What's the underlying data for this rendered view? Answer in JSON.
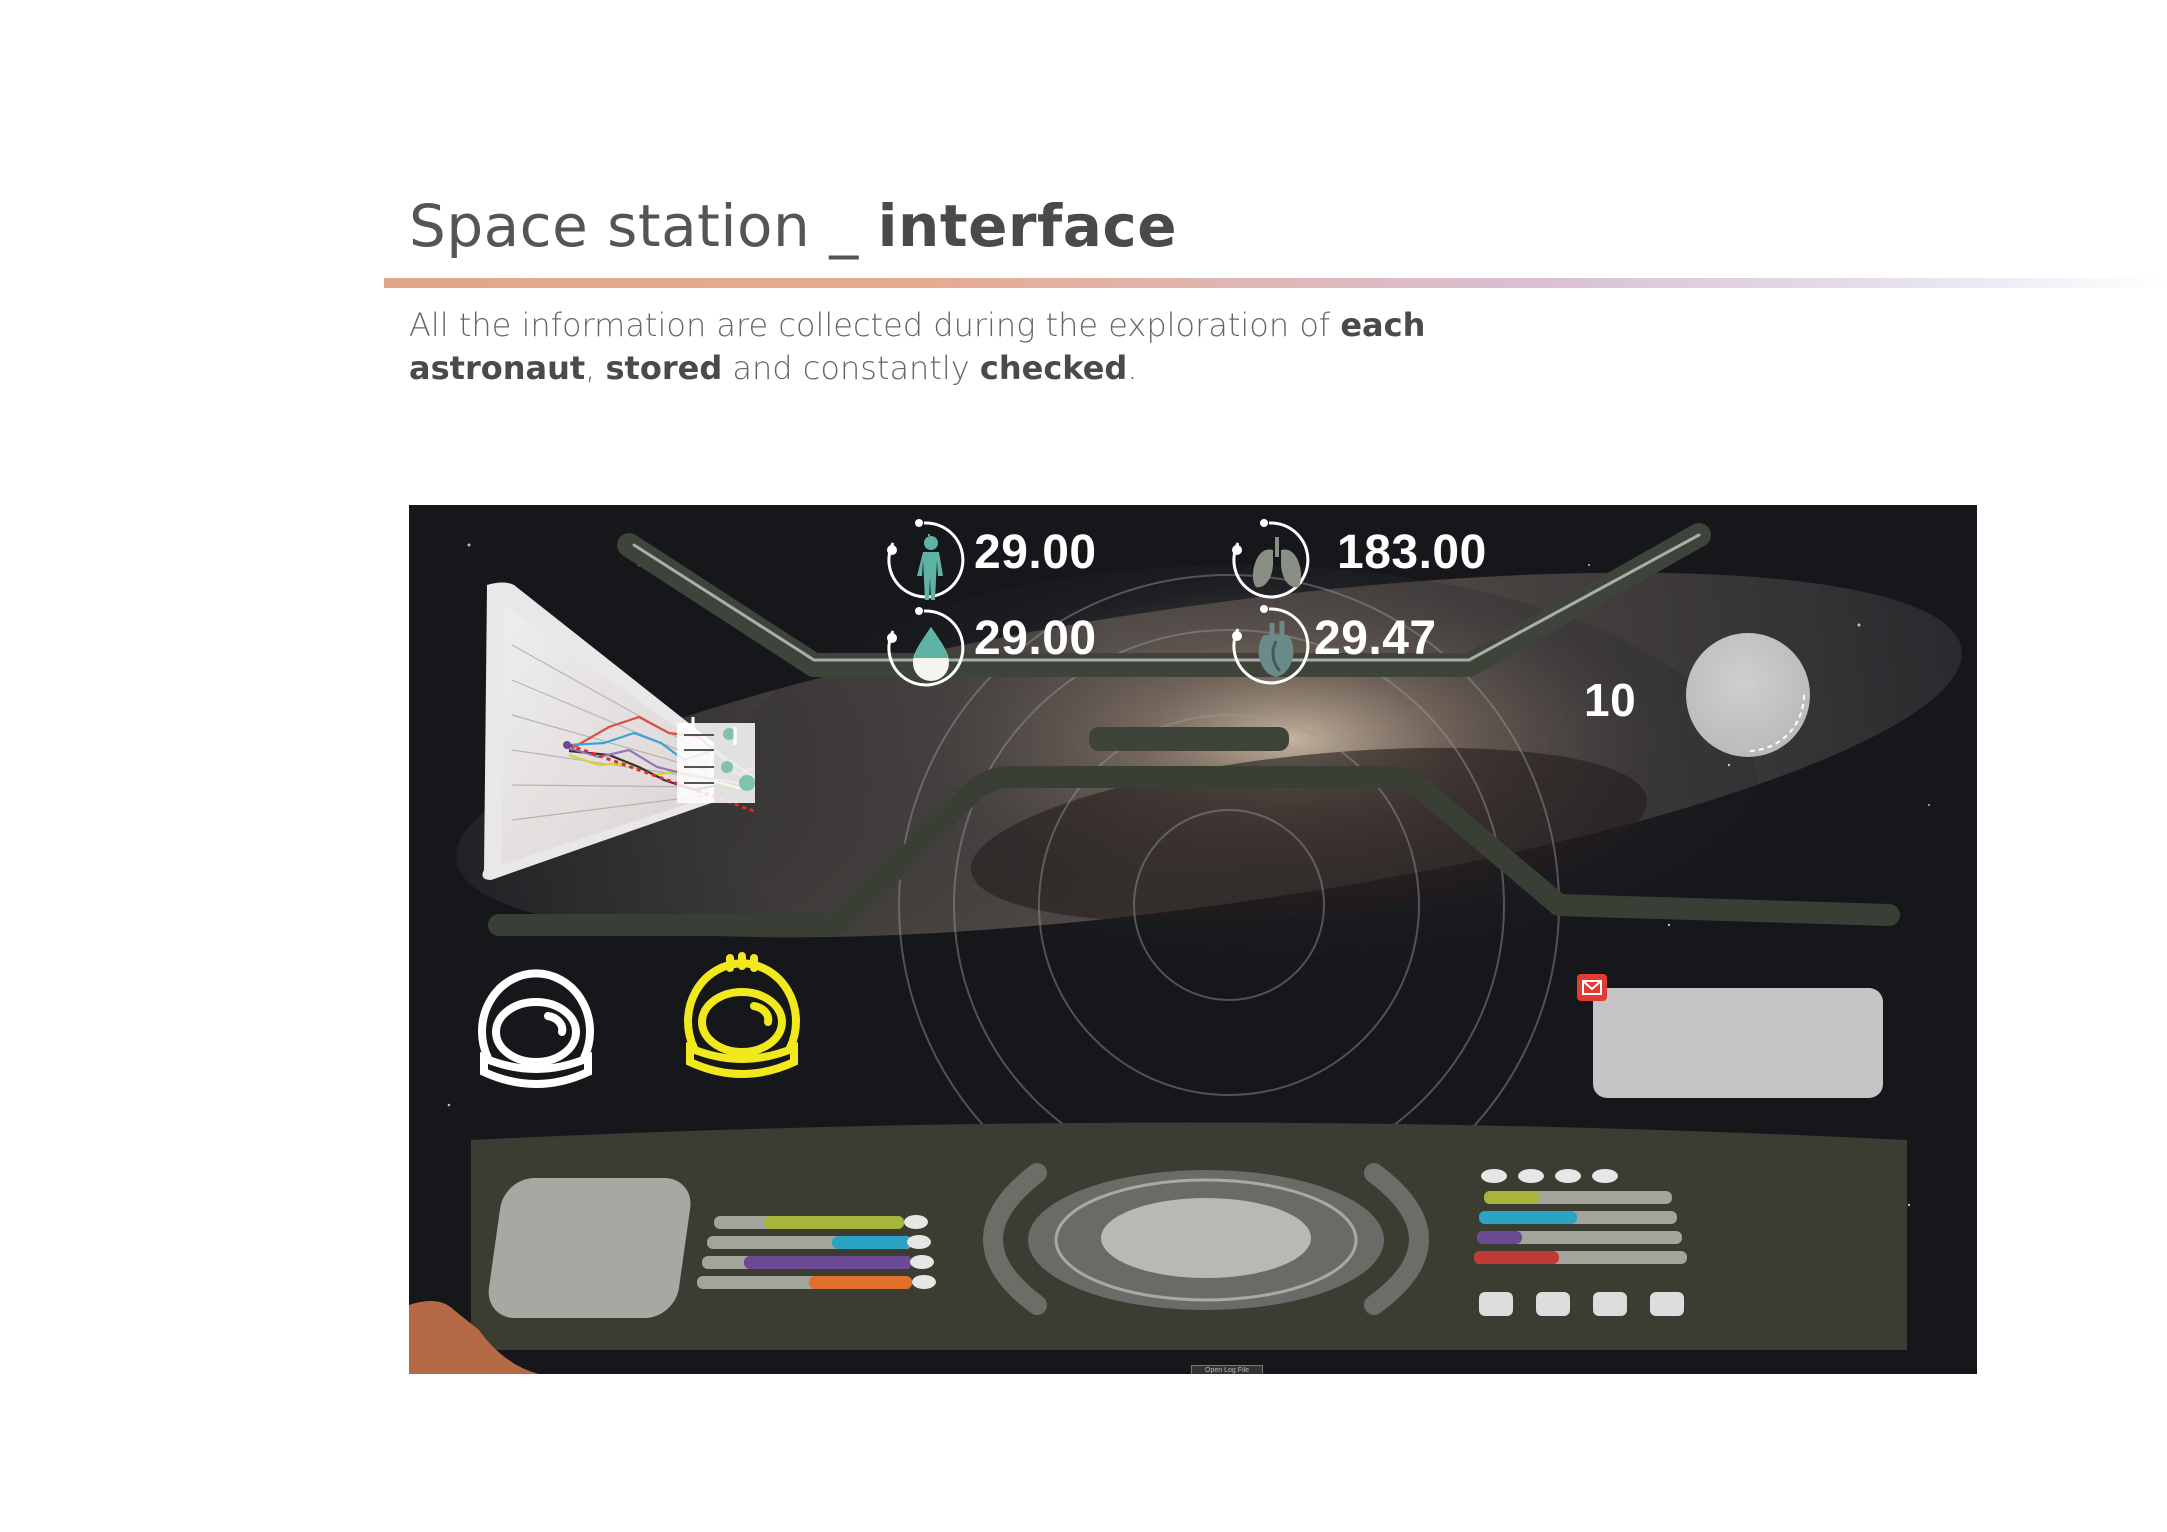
{
  "page": {
    "title_light": "Space station _ ",
    "title_bold": "interface",
    "subtitle": [
      {
        "text": "All the information are collected during the exploration of ",
        "bold": false
      },
      {
        "text": "each astronaut",
        "bold": true
      },
      {
        "text": ", ",
        "bold": false
      },
      {
        "text": "stored",
        "bold": true
      },
      {
        "text": " and constantly ",
        "bold": false
      },
      {
        "text": "checked",
        "bold": true
      },
      {
        "text": ".",
        "bold": false
      }
    ]
  },
  "hud": {
    "vitals": [
      {
        "id": "body",
        "icon": "human-body-icon",
        "value": "29.00"
      },
      {
        "id": "lungs",
        "icon": "lungs-icon",
        "value": "183.00"
      },
      {
        "id": "water",
        "icon": "water-drop-icon",
        "value": "29.00"
      },
      {
        "id": "heart",
        "icon": "heart-icon",
        "value": "29.47"
      }
    ],
    "timer_value": "10",
    "helmets": [
      {
        "icon": "astronaut-helmet-icon",
        "color": "#ffffff"
      },
      {
        "icon": "astronaut-helmet-icon",
        "color": "#f2e81e"
      }
    ],
    "message_icon": "mail-icon",
    "log_button": "Open Log File"
  },
  "colors": {
    "accent_green": "#a7b53a",
    "accent_cyan": "#2aa3c4",
    "accent_purple": "#6a4a92",
    "accent_orange": "#e0702c",
    "accent_red": "#c23a36",
    "helmet_yellow": "#f2e81e",
    "console": "#3b3d33"
  }
}
